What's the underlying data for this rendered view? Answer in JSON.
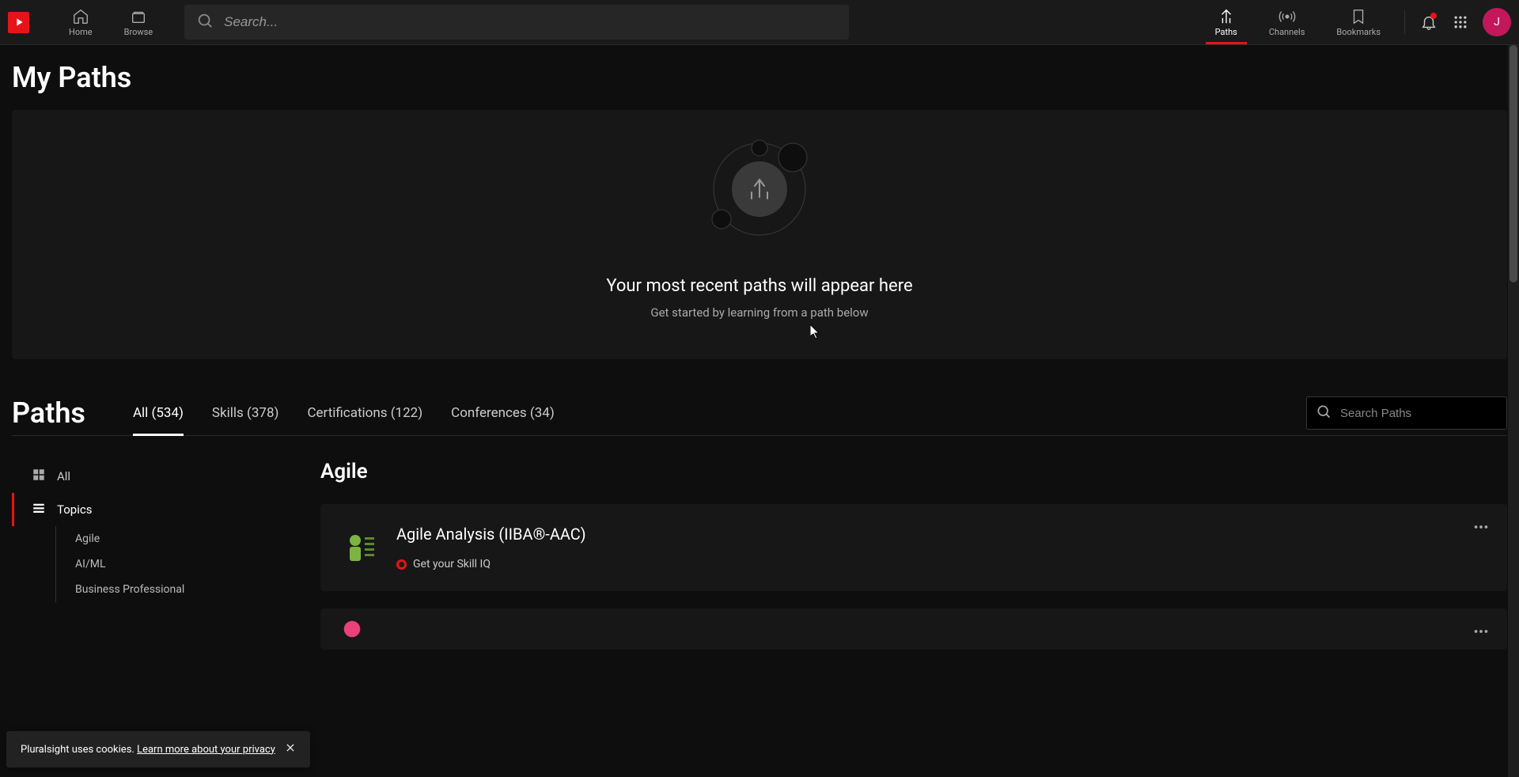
{
  "header": {
    "nav": {
      "home": "Home",
      "browse": "Browse",
      "paths": "Paths",
      "channels": "Channels",
      "bookmarks": "Bookmarks"
    },
    "search_placeholder": "Search...",
    "avatar_initial": "J"
  },
  "page": {
    "title": "My Paths"
  },
  "empty_state": {
    "title": "Your most recent paths will appear here",
    "subtitle": "Get started by learning from a path below"
  },
  "paths_section": {
    "title": "Paths",
    "tabs": {
      "all": "All (534)",
      "skills": "Skills (378)",
      "certifications": "Certifications (122)",
      "conferences": "Conferences (34)"
    },
    "search_placeholder": "Search Paths"
  },
  "sidebar": {
    "all": "All",
    "topics": "Topics",
    "subtopics": {
      "agile": "Agile",
      "aiml": "AI/ML",
      "business": "Business Professional"
    }
  },
  "category": {
    "title": "Agile"
  },
  "path_card": {
    "title": "Agile Analysis (IIBA®-AAC)",
    "skill_iq": "Get your Skill IQ"
  },
  "cookie": {
    "text": "Pluralsight uses cookies.",
    "link": "Learn more about your privacy"
  }
}
